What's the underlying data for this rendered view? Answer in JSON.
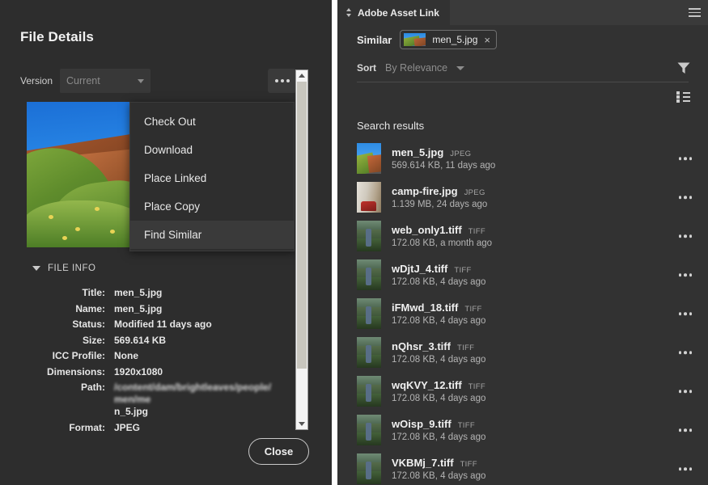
{
  "left_panel": {
    "title": "File Details",
    "version": {
      "label": "Version",
      "value": "Current"
    },
    "more_button": "more-options",
    "context_menu": {
      "items": [
        {
          "label": "Check Out",
          "selected": false
        },
        {
          "label": "Download",
          "selected": false
        },
        {
          "label": "Place Linked",
          "selected": false
        },
        {
          "label": "Place Copy",
          "selected": false
        },
        {
          "label": "Find Similar",
          "selected": true
        }
      ]
    },
    "file_info": {
      "section_label": "FILE INFO",
      "rows": [
        {
          "key": "Title:",
          "value": "men_5.jpg",
          "blurred": false
        },
        {
          "key": "Name:",
          "value": "men_5.jpg",
          "blurred": false
        },
        {
          "key": "Status:",
          "value": "Modified 11 days ago",
          "blurred": false
        },
        {
          "key": "Size:",
          "value": "569.614 KB",
          "blurred": false
        },
        {
          "key": "ICC Profile:",
          "value": "None",
          "blurred": false
        },
        {
          "key": "Dimensions:",
          "value": "1920x1080",
          "blurred": false
        },
        {
          "key": "Path:",
          "value": "/content/dam/brightleaves/people/men/me",
          "value_tail": "n_5.jpg",
          "blurred": true
        },
        {
          "key": "Format:",
          "value": "JPEG",
          "blurred": false
        }
      ]
    },
    "close_label": "Close"
  },
  "right_panel": {
    "tab": "Adobe Asset Link",
    "similar": {
      "label": "Similar",
      "chip_name": "men_5.jpg",
      "chip_close": "×"
    },
    "sort": {
      "label": "Sort",
      "value": "By Relevance"
    },
    "results_title": "Search results",
    "results": [
      {
        "name": "men_5.jpg",
        "type": "JPEG",
        "sub": "569.614 KB, 11 days ago",
        "thumb": "men"
      },
      {
        "name": "camp-fire.jpg",
        "type": "JPEG",
        "sub": "1.139 MB, 24 days ago",
        "thumb": "camp"
      },
      {
        "name": "web_only1.tiff",
        "type": "TIFF",
        "sub": "172.08 KB, a month ago",
        "thumb": "green"
      },
      {
        "name": "wDjtJ_4.tiff",
        "type": "TIFF",
        "sub": "172.08 KB, 4 days ago",
        "thumb": "green"
      },
      {
        "name": "iFMwd_18.tiff",
        "type": "TIFF",
        "sub": "172.08 KB, 4 days ago",
        "thumb": "green"
      },
      {
        "name": "nQhsr_3.tiff",
        "type": "TIFF",
        "sub": "172.08 KB, 4 days ago",
        "thumb": "green"
      },
      {
        "name": "wqKVY_12.tiff",
        "type": "TIFF",
        "sub": "172.08 KB, 4 days ago",
        "thumb": "green"
      },
      {
        "name": "wOisp_9.tiff",
        "type": "TIFF",
        "sub": "172.08 KB, 4 days ago",
        "thumb": "green"
      },
      {
        "name": "VKBMj_7.tiff",
        "type": "TIFF",
        "sub": "172.08 KB, 4 days ago",
        "thumb": "green"
      }
    ]
  },
  "colors": {
    "left_panel_bg": "#2d2d2d",
    "right_panel_bg": "#323232",
    "tabbar_bg": "#3a3a3a",
    "menu_bg": "#2e2e2e",
    "menu_selected": "#3a3a3a",
    "divider": "#ffffff",
    "text_primary": "#f0f0f0",
    "text_muted": "#8d8d8d"
  }
}
